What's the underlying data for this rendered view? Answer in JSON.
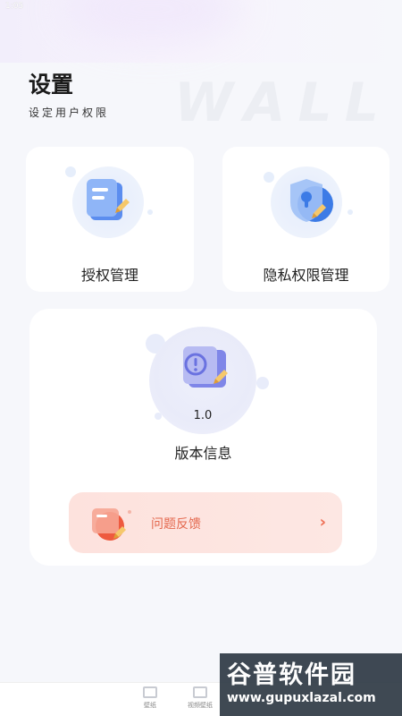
{
  "status_bar": {
    "time": "1:05"
  },
  "header": {
    "title": "设置",
    "subtitle": "设定用户权限",
    "watermark": "WALL"
  },
  "cards": {
    "auth": {
      "label": "授权管理",
      "icon": "document-edit-icon"
    },
    "privacy": {
      "label": "隐私权限管理",
      "icon": "shield-lock-icon"
    },
    "version": {
      "number": "1.0",
      "label": "版本信息",
      "icon": "info-alert-icon"
    }
  },
  "feedback": {
    "label": "问题反馈",
    "icon": "feedback-note-icon",
    "arrow": "›"
  },
  "tabbar": {
    "items": [
      {
        "label": "壁纸"
      },
      {
        "label": "视频壁纸"
      }
    ]
  },
  "site_watermark": {
    "title": "谷普软件园",
    "url": "www.gupuxlazal.com"
  },
  "colors": {
    "background": "#f6f7fb",
    "card": "#ffffff",
    "accent_blue": "#5b8def",
    "feedback_text": "#e4684e",
    "feedback_bg": "#fde2dd"
  }
}
